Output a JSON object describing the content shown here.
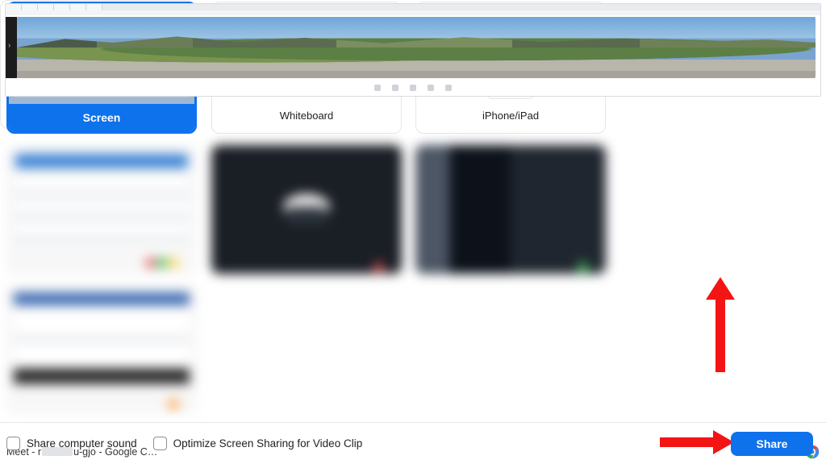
{
  "tiles": {
    "screen": {
      "label": "Screen"
    },
    "whiteboard": {
      "label": "Whiteboard"
    },
    "iphone": {
      "label": "iPhone/iPad"
    },
    "meet": {
      "label_prefix": "Meet - r",
      "label_suffix": "u-gjo - Google C…"
    }
  },
  "footer": {
    "sound": "Share computer sound",
    "optimize": "Optimize Screen Sharing for Video Clip",
    "share": "Share"
  }
}
